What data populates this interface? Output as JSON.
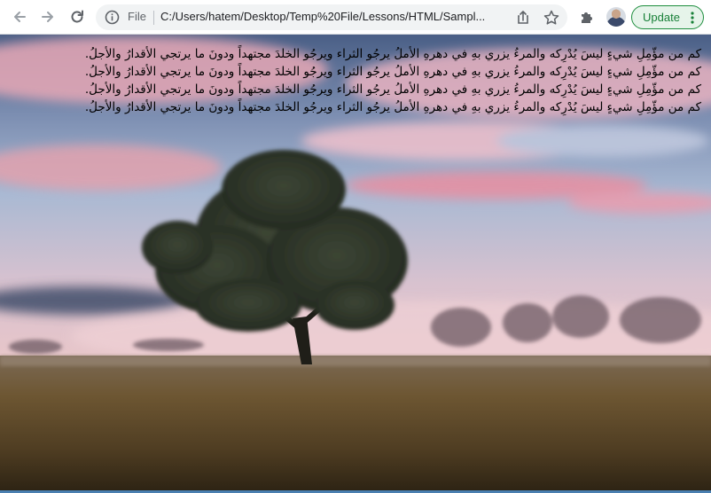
{
  "browser": {
    "file_label": "File",
    "url": "C:/Users/hatem/Desktop/Temp%20File/Lessons/HTML/Sampl...",
    "update_label": "Update",
    "icons": [
      "back-icon",
      "forward-icon",
      "reload-icon",
      "info-icon",
      "share-icon",
      "star-icon",
      "extensions-icon",
      "profile-avatar",
      "kebab-menu-icon"
    ]
  },
  "page": {
    "lines": [
      "كم من مؤّمِلِ شيءٍ ليسَ يُدْرِكه والمرءُ يزري بهِ في دهرهِ الأملُ يرجُو الثراء ويرجُو الخلدَ مجتهداً ودونَ ما يرتجي الأقدارُ والأجلُ.",
      "كم من مؤّمِلِ شيءٍ ليسَ يُدْرِكه والمرءُ يزري بهِ في دهرهِ الأملُ يرجُو الثراء ويرجُو الخلدَ مجتهداً ودونَ ما يرتجي الأقدارُ والأجلُ.",
      "كم من مؤّمِلِ شيءٍ ليسَ يُدْرِكه والمرءُ يزري بهِ في دهرهِ الأملُ يرجُو الثراء ويرجُو الخلدَ مجتهداً ودونَ ما يرتجي الأقدارُ والأجلُ.",
      "كم من مؤّمِلِ شيءٍ ليسَ يُدْرِكه والمرءُ يزري بهِ في دهرهِ الأملُ يرجُو الثراء ويرجُو الخلدَ مجتهداً ودونَ ما يرتجي الأقدارُ والأجلُ."
    ],
    "background_image": "lone-tree-field-sunset",
    "accent_color": "#1e8e3e"
  }
}
